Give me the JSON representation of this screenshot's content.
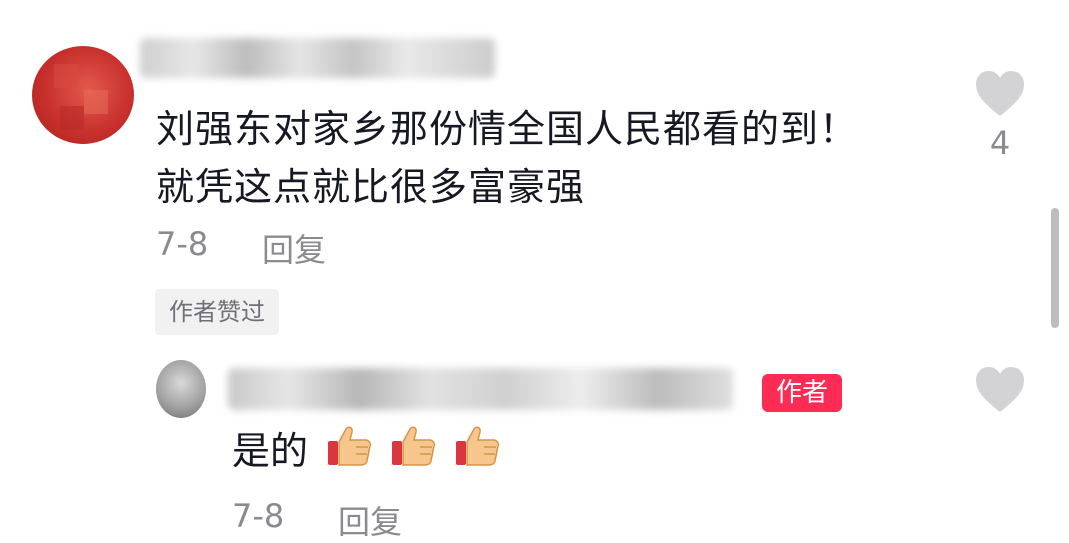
{
  "comment": {
    "text": "刘强东对家乡那份情全国人民都看的到！\n就凭这点就比很多富豪强",
    "date": "7-8",
    "reply_label": "回复",
    "author_liked_badge": "作者赞过",
    "like_count": "4"
  },
  "reply": {
    "author_tag": "作者",
    "text": "是的",
    "emojis": [
      "thumbs-up",
      "thumbs-up",
      "thumbs-up"
    ],
    "date": "7-8",
    "reply_label": "回复"
  },
  "colors": {
    "author_tag_bg": "#fe2c55",
    "heart": "#d3d3d5",
    "meta_text": "#8a8b91"
  }
}
